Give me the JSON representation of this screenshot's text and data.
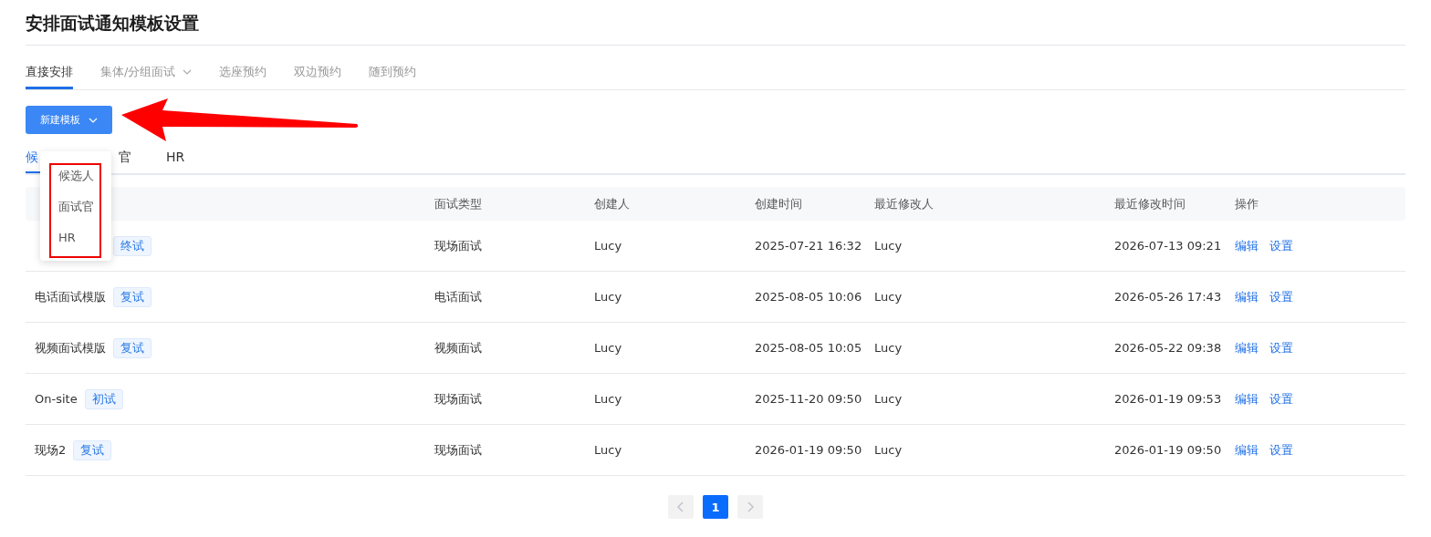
{
  "page_title": "安排面试通知模板设置",
  "tabs": [
    {
      "label": "直接安排",
      "selected": true,
      "has_caret": false
    },
    {
      "label": "集体/分组面试",
      "selected": false,
      "has_caret": true
    },
    {
      "label": "选座预约",
      "selected": false,
      "has_caret": false
    },
    {
      "label": "双边预约",
      "selected": false,
      "has_caret": false
    },
    {
      "label": "随到预约",
      "selected": false,
      "has_caret": false
    }
  ],
  "new_button": {
    "label": "新建模板"
  },
  "dropdown": {
    "items": [
      "候选人",
      "面试官",
      "HR"
    ]
  },
  "sub_tabs": [
    {
      "label": "候",
      "selected": true
    },
    {
      "label": "官",
      "selected": false
    },
    {
      "label": "HR",
      "selected": false
    }
  ],
  "table": {
    "columns": [
      null,
      "面试类型",
      "创建人",
      "创建时间",
      "最近修改人",
      "最近修改时间",
      "操作"
    ],
    "rows": [
      {
        "tag": "终试",
        "type": "现场面试",
        "creator": "Lucy",
        "created": "2025-07-21 16:32",
        "modifier": "Lucy",
        "modified": "2026-07-13 09:21",
        "actions": [
          "编辑",
          "设置"
        ]
      },
      {
        "name": "电话面试模版",
        "tag": "复试",
        "type": "电话面试",
        "creator": "Lucy",
        "created": "2025-08-05 10:06",
        "modifier": "Lucy",
        "modified": "2026-05-26 17:43",
        "actions": [
          "编辑",
          "设置"
        ]
      },
      {
        "name": "视频面试模版",
        "tag": "复试",
        "type": "视频面试",
        "creator": "Lucy",
        "created": "2025-08-05 10:05",
        "modifier": "Lucy",
        "modified": "2026-05-22 09:38",
        "actions": [
          "编辑",
          "设置"
        ]
      },
      {
        "name": "On-site",
        "tag": "初试",
        "type": "现场面试",
        "creator": "Lucy",
        "created": "2025-11-20 09:50",
        "modifier": "Lucy",
        "modified": "2026-01-19 09:53",
        "actions": [
          "编辑",
          "设置"
        ]
      },
      {
        "name": "现场2",
        "tag": "复试",
        "type": "现场面试",
        "creator": "Lucy",
        "created": "2026-01-19 09:50",
        "modifier": "Lucy",
        "modified": "2026-01-19 09:50",
        "actions": [
          "编辑",
          "设置"
        ]
      }
    ]
  },
  "pagination": {
    "pages": [
      {
        "label": "1",
        "selected": true
      }
    ]
  }
}
